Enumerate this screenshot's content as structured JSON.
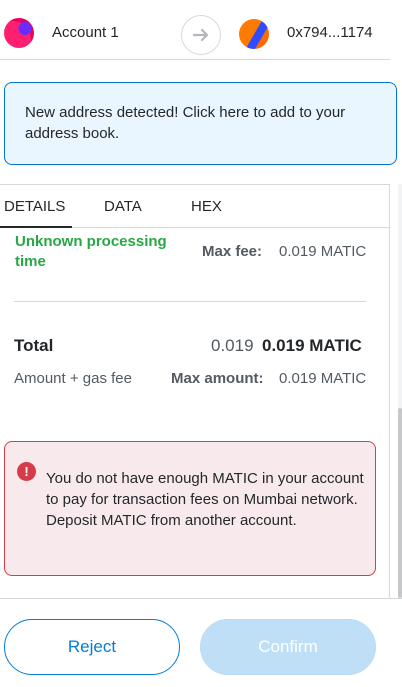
{
  "header": {
    "from_account": "Account 1",
    "to_address": "0x794...1174",
    "arrow_icon": "arrow-right-icon"
  },
  "banner": {
    "text": "New address detected! Click here to add to your address book."
  },
  "tabs": [
    {
      "label": "DETAILS",
      "active": true
    },
    {
      "label": "DATA",
      "active": false
    },
    {
      "label": "HEX",
      "active": false
    }
  ],
  "gas": {
    "processing_text": "Unknown processing time",
    "max_fee_label": "Max fee:",
    "max_fee_value": "0.019 MATIC"
  },
  "total": {
    "label": "Total",
    "secondary_value": "0.019",
    "primary_value": "0.019 MATIC",
    "subtitle": "Amount + gas fee",
    "max_amount_label": "Max amount:",
    "max_amount_value": "0.019 MATIC"
  },
  "error": {
    "icon": "error-info-icon",
    "text": "You do not have enough MATIC in your account to pay for transaction fees on Mumbai network. Deposit MATIC from another account."
  },
  "buttons": {
    "reject": "Reject",
    "confirm": "Confirm"
  },
  "colors": {
    "primary": "#037dd6",
    "success": "#28a745",
    "error": "#d73a49",
    "info_bg": "#eaf6ff"
  }
}
